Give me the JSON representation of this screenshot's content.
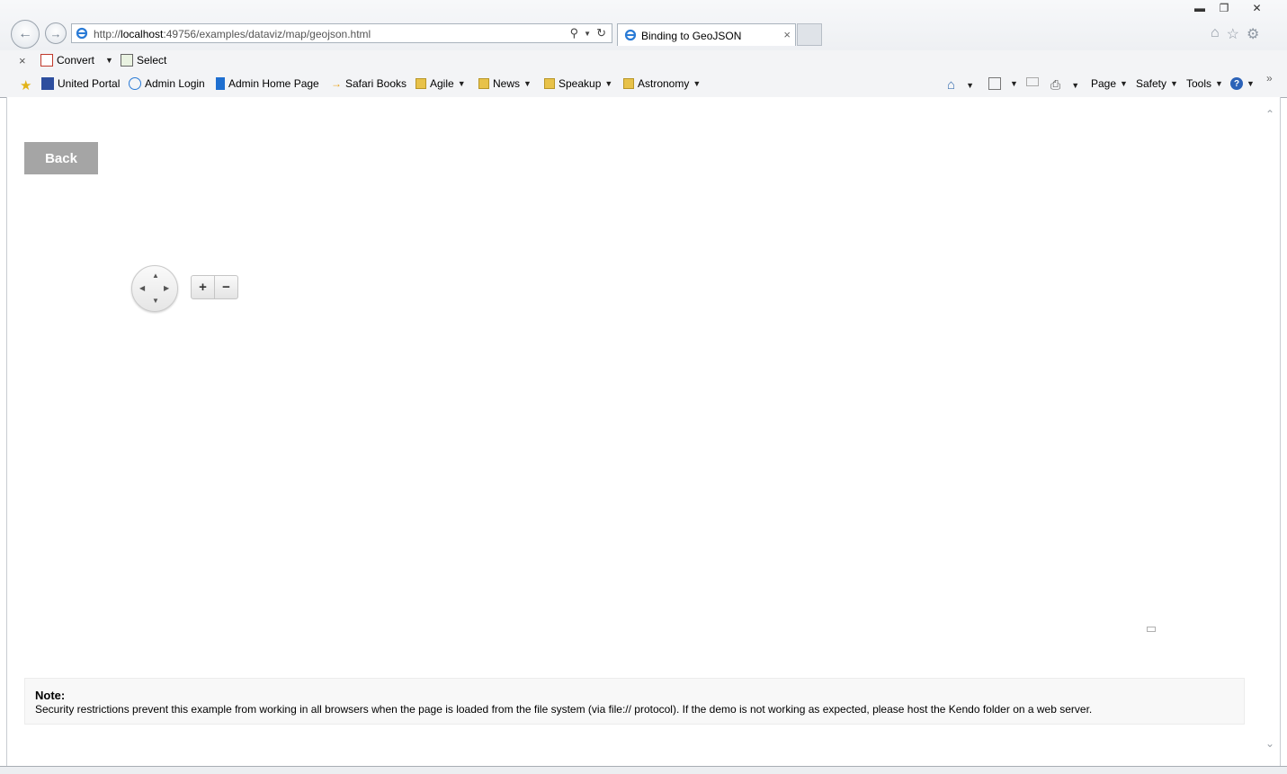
{
  "browser": {
    "address_url_prefix": "http://",
    "address_url_host": "localhost",
    "address_url_rest": ":49756/examples/dataviz/map/geojson.html",
    "tab_title": "Binding to GeoJSON",
    "tab_close": "×"
  },
  "command_bar": {
    "close": "×",
    "convert": "Convert",
    "select": "Select"
  },
  "favorites": [
    {
      "label": "United Portal"
    },
    {
      "label": "Admin Login"
    },
    {
      "label": "Admin Home Page"
    },
    {
      "label": "Safari Books"
    },
    {
      "label": "Agile"
    },
    {
      "label": "News"
    },
    {
      "label": "Speakup"
    },
    {
      "label": "Astronomy"
    }
  ],
  "toolbar_right": {
    "page": "Page",
    "safety": "Safety",
    "tools": "Tools"
  },
  "page": {
    "back_button": "Back",
    "zoom_in": "+",
    "zoom_out": "−",
    "note_title": "Note:",
    "note_body": "Security restrictions prevent this example from working in all browsers when the page is loaded from the file system (via file:// protocol). If the demo is not working as expected, please host the Kendo folder on a web server."
  },
  "colors": {
    "back_button_bg": "#a5a5a5",
    "note_bg": "#f8f8f8"
  }
}
